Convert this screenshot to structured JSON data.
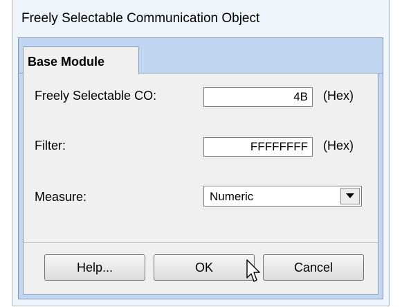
{
  "window": {
    "title": "Freely Selectable Communication Object"
  },
  "tabs": [
    {
      "label": "Base Module",
      "active": true
    }
  ],
  "form": {
    "co_label": "Freely Selectable CO:",
    "co_value": "4B",
    "co_unit": "(Hex)",
    "filter_label": "Filter:",
    "filter_value": "FFFFFFFF",
    "filter_unit": "(Hex)",
    "measure_label": "Measure:",
    "measure_value": "Numeric"
  },
  "buttons": {
    "help": "Help...",
    "ok": "OK",
    "cancel": "Cancel"
  },
  "icons": {
    "dropdown": "chevron-down-icon",
    "cursor": "mouse-pointer-icon"
  },
  "colors": {
    "client_area": "#c1d6f0",
    "dialog_bg": "#eef4fa",
    "panel_bg": "#f0f0f0"
  }
}
